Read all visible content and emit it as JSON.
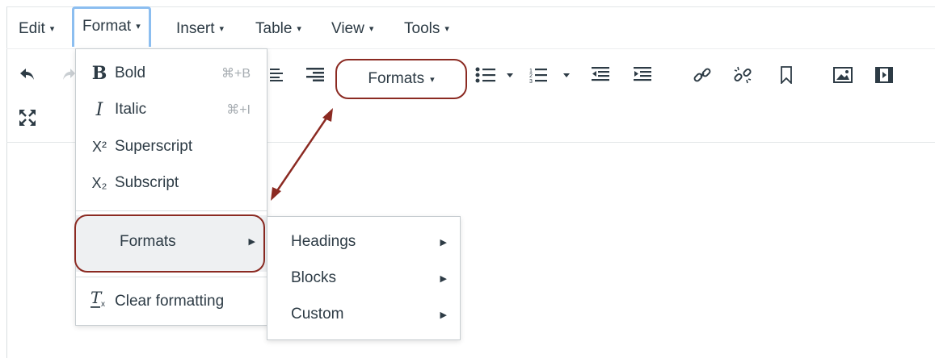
{
  "menubar": {
    "items": [
      {
        "label": "Edit",
        "caret": "▾"
      },
      {
        "label": "Format",
        "caret": "▾"
      },
      {
        "label": "Insert",
        "caret": "▾"
      },
      {
        "label": "Table",
        "caret": "▾"
      },
      {
        "label": "View",
        "caret": "▾"
      },
      {
        "label": "Tools",
        "caret": "▾"
      }
    ],
    "active": "Format"
  },
  "toolbar": {
    "formats_label": "Formats",
    "formats_caret": "▾",
    "icons": [
      "undo-icon",
      "redo-icon",
      "align-center-icon",
      "align-right-icon",
      "bullet-list-icon",
      "numbered-list-icon",
      "outdent-icon",
      "indent-icon",
      "link-icon",
      "unlink-icon",
      "bookmark-icon",
      "image-icon",
      "media-icon",
      "fullscreen-icon"
    ]
  },
  "format_menu": {
    "items": [
      {
        "icon_glyph": "B",
        "label": "Bold",
        "shortcut": "⌘+B"
      },
      {
        "icon_glyph": "I",
        "label": "Italic",
        "shortcut": "⌘+I"
      },
      {
        "icon_glyph": "X²",
        "label": "Superscript",
        "shortcut": ""
      },
      {
        "icon_glyph": "X₂",
        "label": "Subscript",
        "shortcut": ""
      }
    ],
    "formats_label": "Formats",
    "clear_label": "Clear formatting"
  },
  "formats_submenu": {
    "items": [
      {
        "label": "Headings"
      },
      {
        "label": "Blocks"
      },
      {
        "label": "Custom"
      }
    ]
  },
  "colors": {
    "annotation": "#8b2a22",
    "active_menu_border": "#8cbef0",
    "text": "#2d3b45"
  }
}
